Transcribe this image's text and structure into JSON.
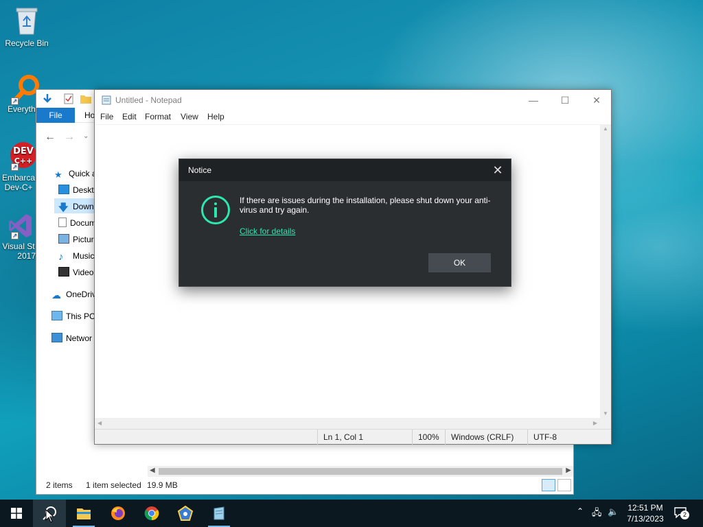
{
  "desktop": {
    "icons": [
      {
        "label": "Recycle Bin"
      },
      {
        "label": "Everythi"
      },
      {
        "label": "Embarca",
        "label2": "Dev-C+"
      },
      {
        "label": "Visual St",
        "label2": "2017"
      }
    ]
  },
  "explorer": {
    "ribbon": {
      "file_tab": "File",
      "home_tab": "Ho"
    },
    "nav": [
      {
        "label": "Quick a"
      },
      {
        "label": "Deskto"
      },
      {
        "label": "Downl"
      },
      {
        "label": "Docum"
      },
      {
        "label": "Pictur"
      },
      {
        "label": "Music"
      },
      {
        "label": "Video"
      },
      {
        "label": "OneDriv"
      },
      {
        "label": "This PC"
      },
      {
        "label": "Networ"
      }
    ],
    "status": {
      "items": "2 items",
      "selected": "1 item selected",
      "size": "19.9 MB"
    }
  },
  "notepad": {
    "title": "Untitled - Notepad",
    "menu": [
      "File",
      "Edit",
      "Format",
      "View",
      "Help"
    ],
    "status": {
      "position": "Ln 1, Col 1",
      "zoom": "100%",
      "line_ending": "Windows (CRLF)",
      "encoding": "UTF-8"
    }
  },
  "dialog": {
    "title": "Notice",
    "message": "If there are issues during the installation, please shut down your anti-virus and try again.",
    "link": "Click for details",
    "ok_label": "OK",
    "accent_color": "#2ee6b0"
  },
  "taskbar": {
    "clock_time": "12:51 PM",
    "clock_date": "7/13/2023",
    "notification_count": "2"
  }
}
